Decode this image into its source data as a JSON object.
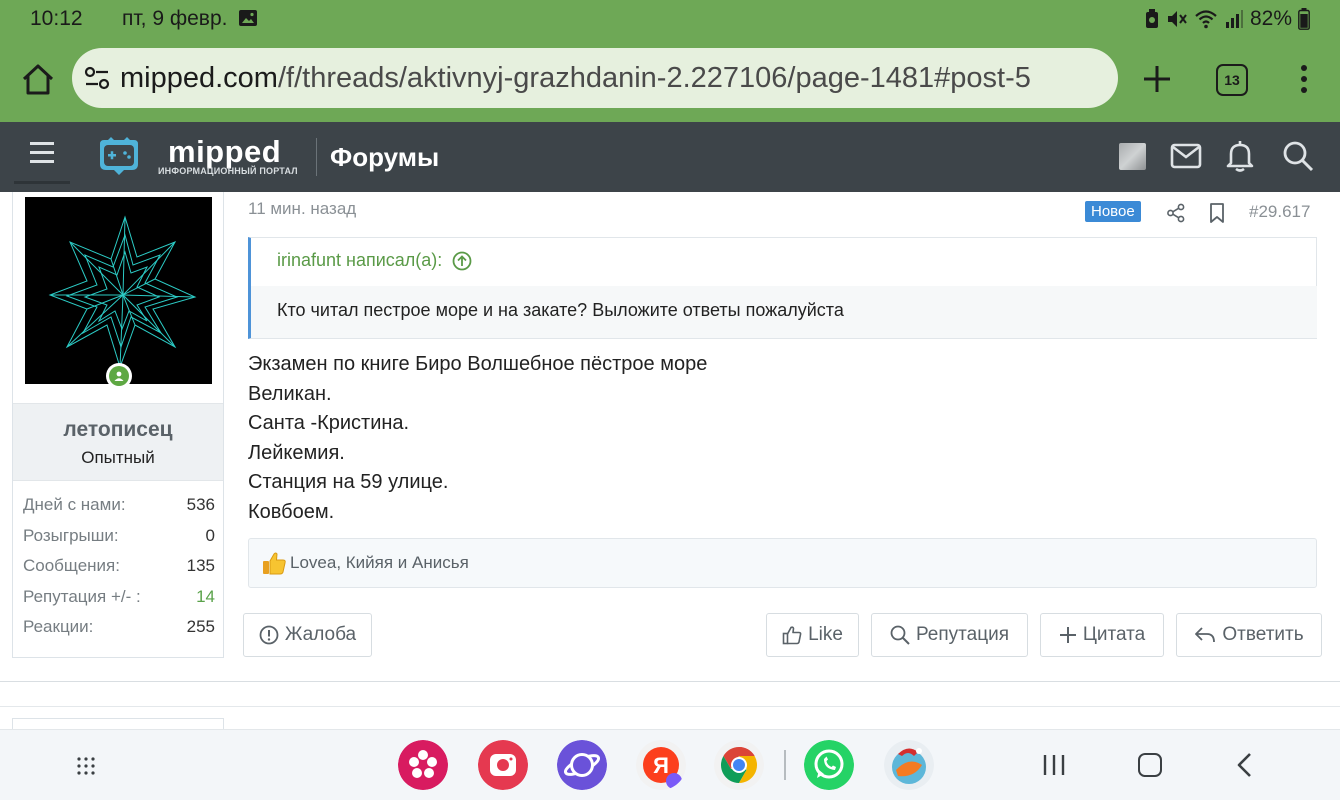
{
  "status_bar": {
    "time": "10:12",
    "date": "пт, 9 февр.",
    "battery": "82%"
  },
  "browser": {
    "url_domain": "mipped.com",
    "url_path": "/f/threads/aktivnyj-grazhdanin-2.227106/page-1481#post-5",
    "tab_count": "13"
  },
  "site": {
    "logo_text": "mipped",
    "logo_subtitle": "ИНФОРМАЦИОННЫЙ ПОРТАЛ",
    "section_title": "Форумы"
  },
  "user": {
    "name": "летописец",
    "title": "Опытный",
    "stats": [
      {
        "label": "Дней с нами:",
        "value": "536"
      },
      {
        "label": "Розыгрыши:",
        "value": "0"
      },
      {
        "label": "Сообщения:",
        "value": "135"
      },
      {
        "label": "Репутация +/- :",
        "value": "14"
      },
      {
        "label": "Реакции:",
        "value": "255"
      }
    ]
  },
  "post": {
    "time": "11 мин. назад",
    "badge": "Новое",
    "number": "#29.617",
    "quote_author": "irinafunt написал(а):",
    "quote_text": "Кто читал пестрое море и на закате? Выложите ответы пожалуйста",
    "body_lines": [
      "Экзамен по книге Биро Волшебное пёстрое море",
      "Великан.",
      "Санта -Кристина.",
      "Лейкемия.",
      "Станция на 59 улице.",
      "Ковбоем."
    ],
    "reactions_text": "Lovea, Кийяя и Анисья"
  },
  "actions": {
    "report": "Жалоба",
    "like": "Like",
    "reputation": "Репутация",
    "quote": "Цитата",
    "reply": "Ответить"
  },
  "colors": {
    "browser_green": "#6ea856",
    "header_dark": "#3d4449",
    "accent_blue": "#3b8ad6",
    "quote_green": "#5a9a47"
  }
}
